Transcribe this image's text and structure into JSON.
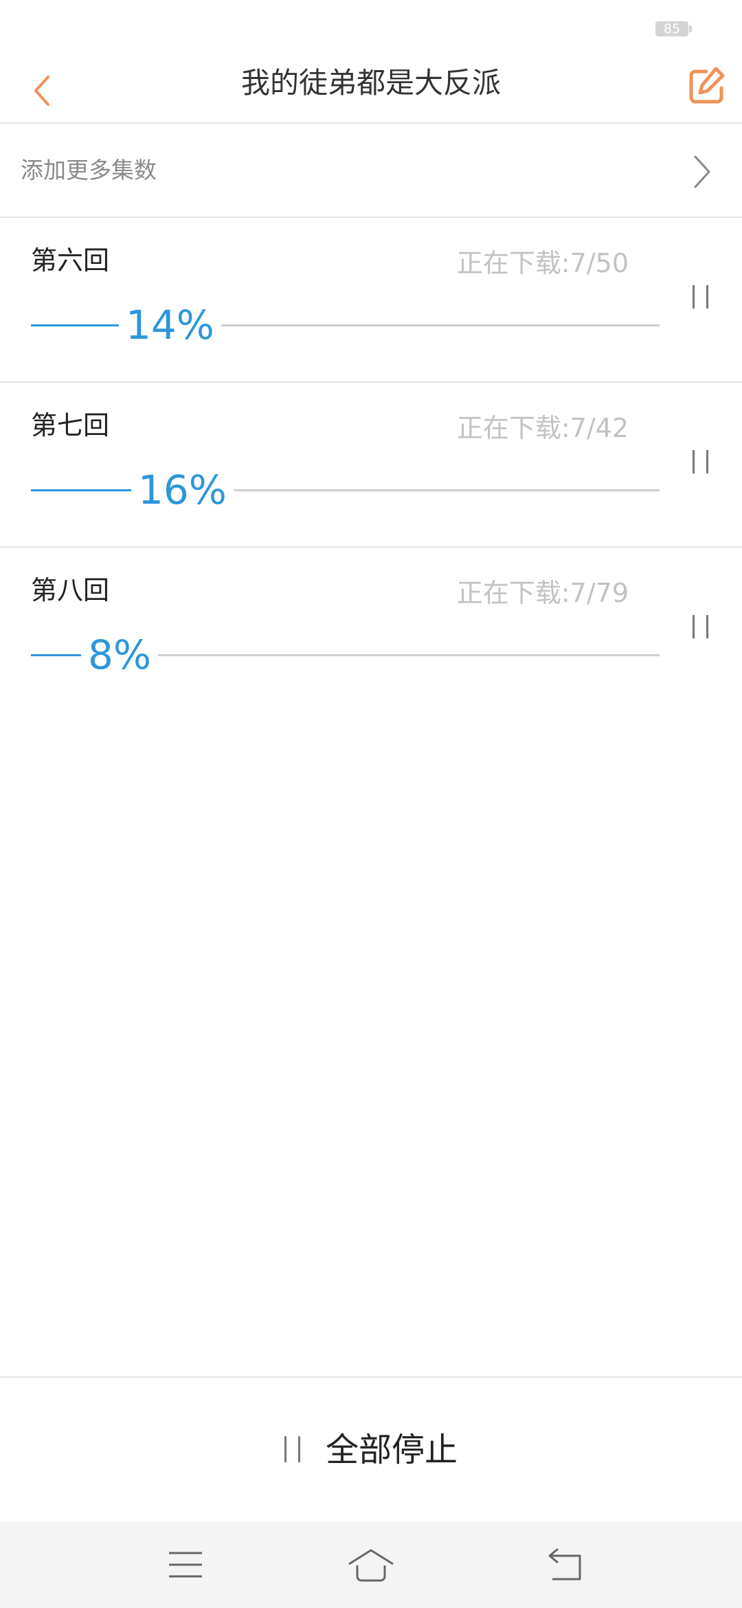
{
  "status_bar": {
    "battery": "85"
  },
  "header": {
    "title": "我的徒弟都是大反派"
  },
  "add_more": {
    "label": "添加更多集数"
  },
  "downloads": [
    {
      "title": "第六回",
      "status": "正在下载:7/50",
      "percent_text": "14%",
      "progress": 0.14
    },
    {
      "title": "第七回",
      "status": "正在下载:7/42",
      "percent_text": "16%",
      "progress": 0.16
    },
    {
      "title": "第八回",
      "status": "正在下载:7/79",
      "percent_text": "8%",
      "progress": 0.08
    }
  ],
  "footer": {
    "stop_all_label": "全部停止"
  },
  "icons": {
    "back": "chevron-left-icon",
    "edit": "edit-icon",
    "add_more": "chevron-right-icon",
    "pause": "pause-icon",
    "nav_menu": "menu-icon",
    "nav_home": "home-icon",
    "nav_back": "back-icon"
  },
  "colors": {
    "accent": "#F0925A",
    "progress": "#2C97DC",
    "track": "#CFCFCF"
  }
}
